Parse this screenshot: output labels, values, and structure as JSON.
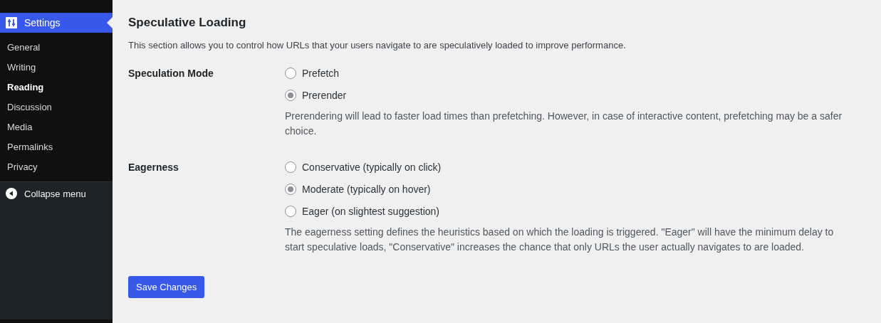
{
  "sidebar": {
    "current": {
      "label": "Settings"
    },
    "items": [
      {
        "label": "General",
        "selected": false
      },
      {
        "label": "Writing",
        "selected": false
      },
      {
        "label": "Reading",
        "selected": true
      },
      {
        "label": "Discussion",
        "selected": false
      },
      {
        "label": "Media",
        "selected": false
      },
      {
        "label": "Permalinks",
        "selected": false
      },
      {
        "label": "Privacy",
        "selected": false
      }
    ],
    "collapse": {
      "label": "Collapse menu"
    }
  },
  "section": {
    "title": "Speculative Loading",
    "description": "This section allows you to control how URLs that your users navigate to are speculatively loaded to improve performance.",
    "fields": [
      {
        "label": "Speculation Mode",
        "options": [
          {
            "label": "Prefetch",
            "selected": false
          },
          {
            "label": "Prerender",
            "selected": true
          }
        ],
        "help": "Prerendering will lead to faster load times than prefetching. However, in case of interactive content, prefetching may be a safer choice."
      },
      {
        "label": "Eagerness",
        "options": [
          {
            "label": "Conservative (typically on click)",
            "selected": false
          },
          {
            "label": "Moderate (typically on hover)",
            "selected": true
          },
          {
            "label": "Eager (on slightest suggestion)",
            "selected": false
          }
        ],
        "help": "The eagerness setting defines the heuristics based on which the loading is triggered. \"Eager\" will have the minimum delay to start speculative loads, \"Conservative\" increases the chance that only URLs the user actually navigates to are loaded."
      }
    ]
  },
  "save_button": "Save Changes"
}
